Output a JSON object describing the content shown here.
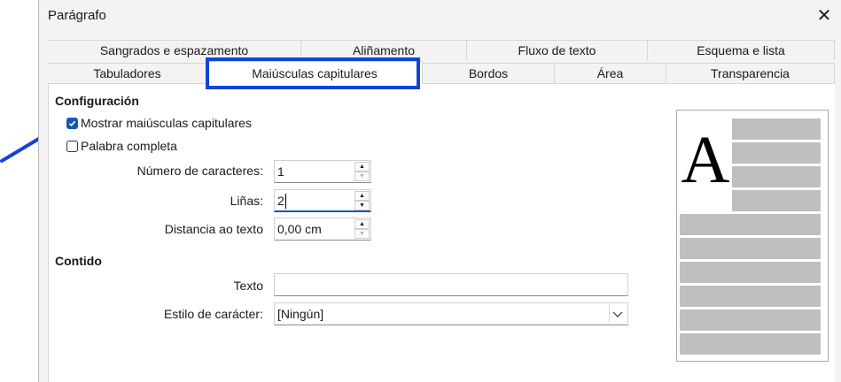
{
  "window": {
    "title": "Parágrafo",
    "close_icon": "close-icon"
  },
  "tabs": {
    "row1": [
      {
        "label": "Sangrados e espazamento"
      },
      {
        "label": "Aliñamento"
      },
      {
        "label": "Fluxo de texto"
      },
      {
        "label": "Esquema e lista"
      }
    ],
    "row2": [
      {
        "label": "Tabuladores"
      },
      {
        "label": "Maiúsculas capitulares",
        "active": true
      },
      {
        "label": "Bordos"
      },
      {
        "label": "Área"
      },
      {
        "label": "Transparencia"
      }
    ]
  },
  "settings": {
    "title": "Configuración",
    "show_dropcaps": {
      "label": "Mostrar maiúsculas capitulares",
      "checked": true
    },
    "whole_word": {
      "label": "Palabra completa",
      "checked": false
    },
    "num_chars": {
      "label": "Número de caracteres:",
      "value": "1"
    },
    "lines": {
      "label": "Liñas:",
      "value": "2"
    },
    "distance": {
      "label": "Distancia ao texto",
      "value": "0,00 cm"
    }
  },
  "contents": {
    "title": "Contido",
    "text": {
      "label": "Texto",
      "value": ""
    },
    "char_style": {
      "label": "Estilo de carácter:",
      "value": "[Ningún]"
    }
  },
  "preview": {
    "letter": "A"
  },
  "annotation": {
    "highlight_color": "#1244d8",
    "arrow_color": "#1244d8"
  },
  "colors": {
    "accent": "#1258b6",
    "preview_lines": "#bfbfbf"
  }
}
